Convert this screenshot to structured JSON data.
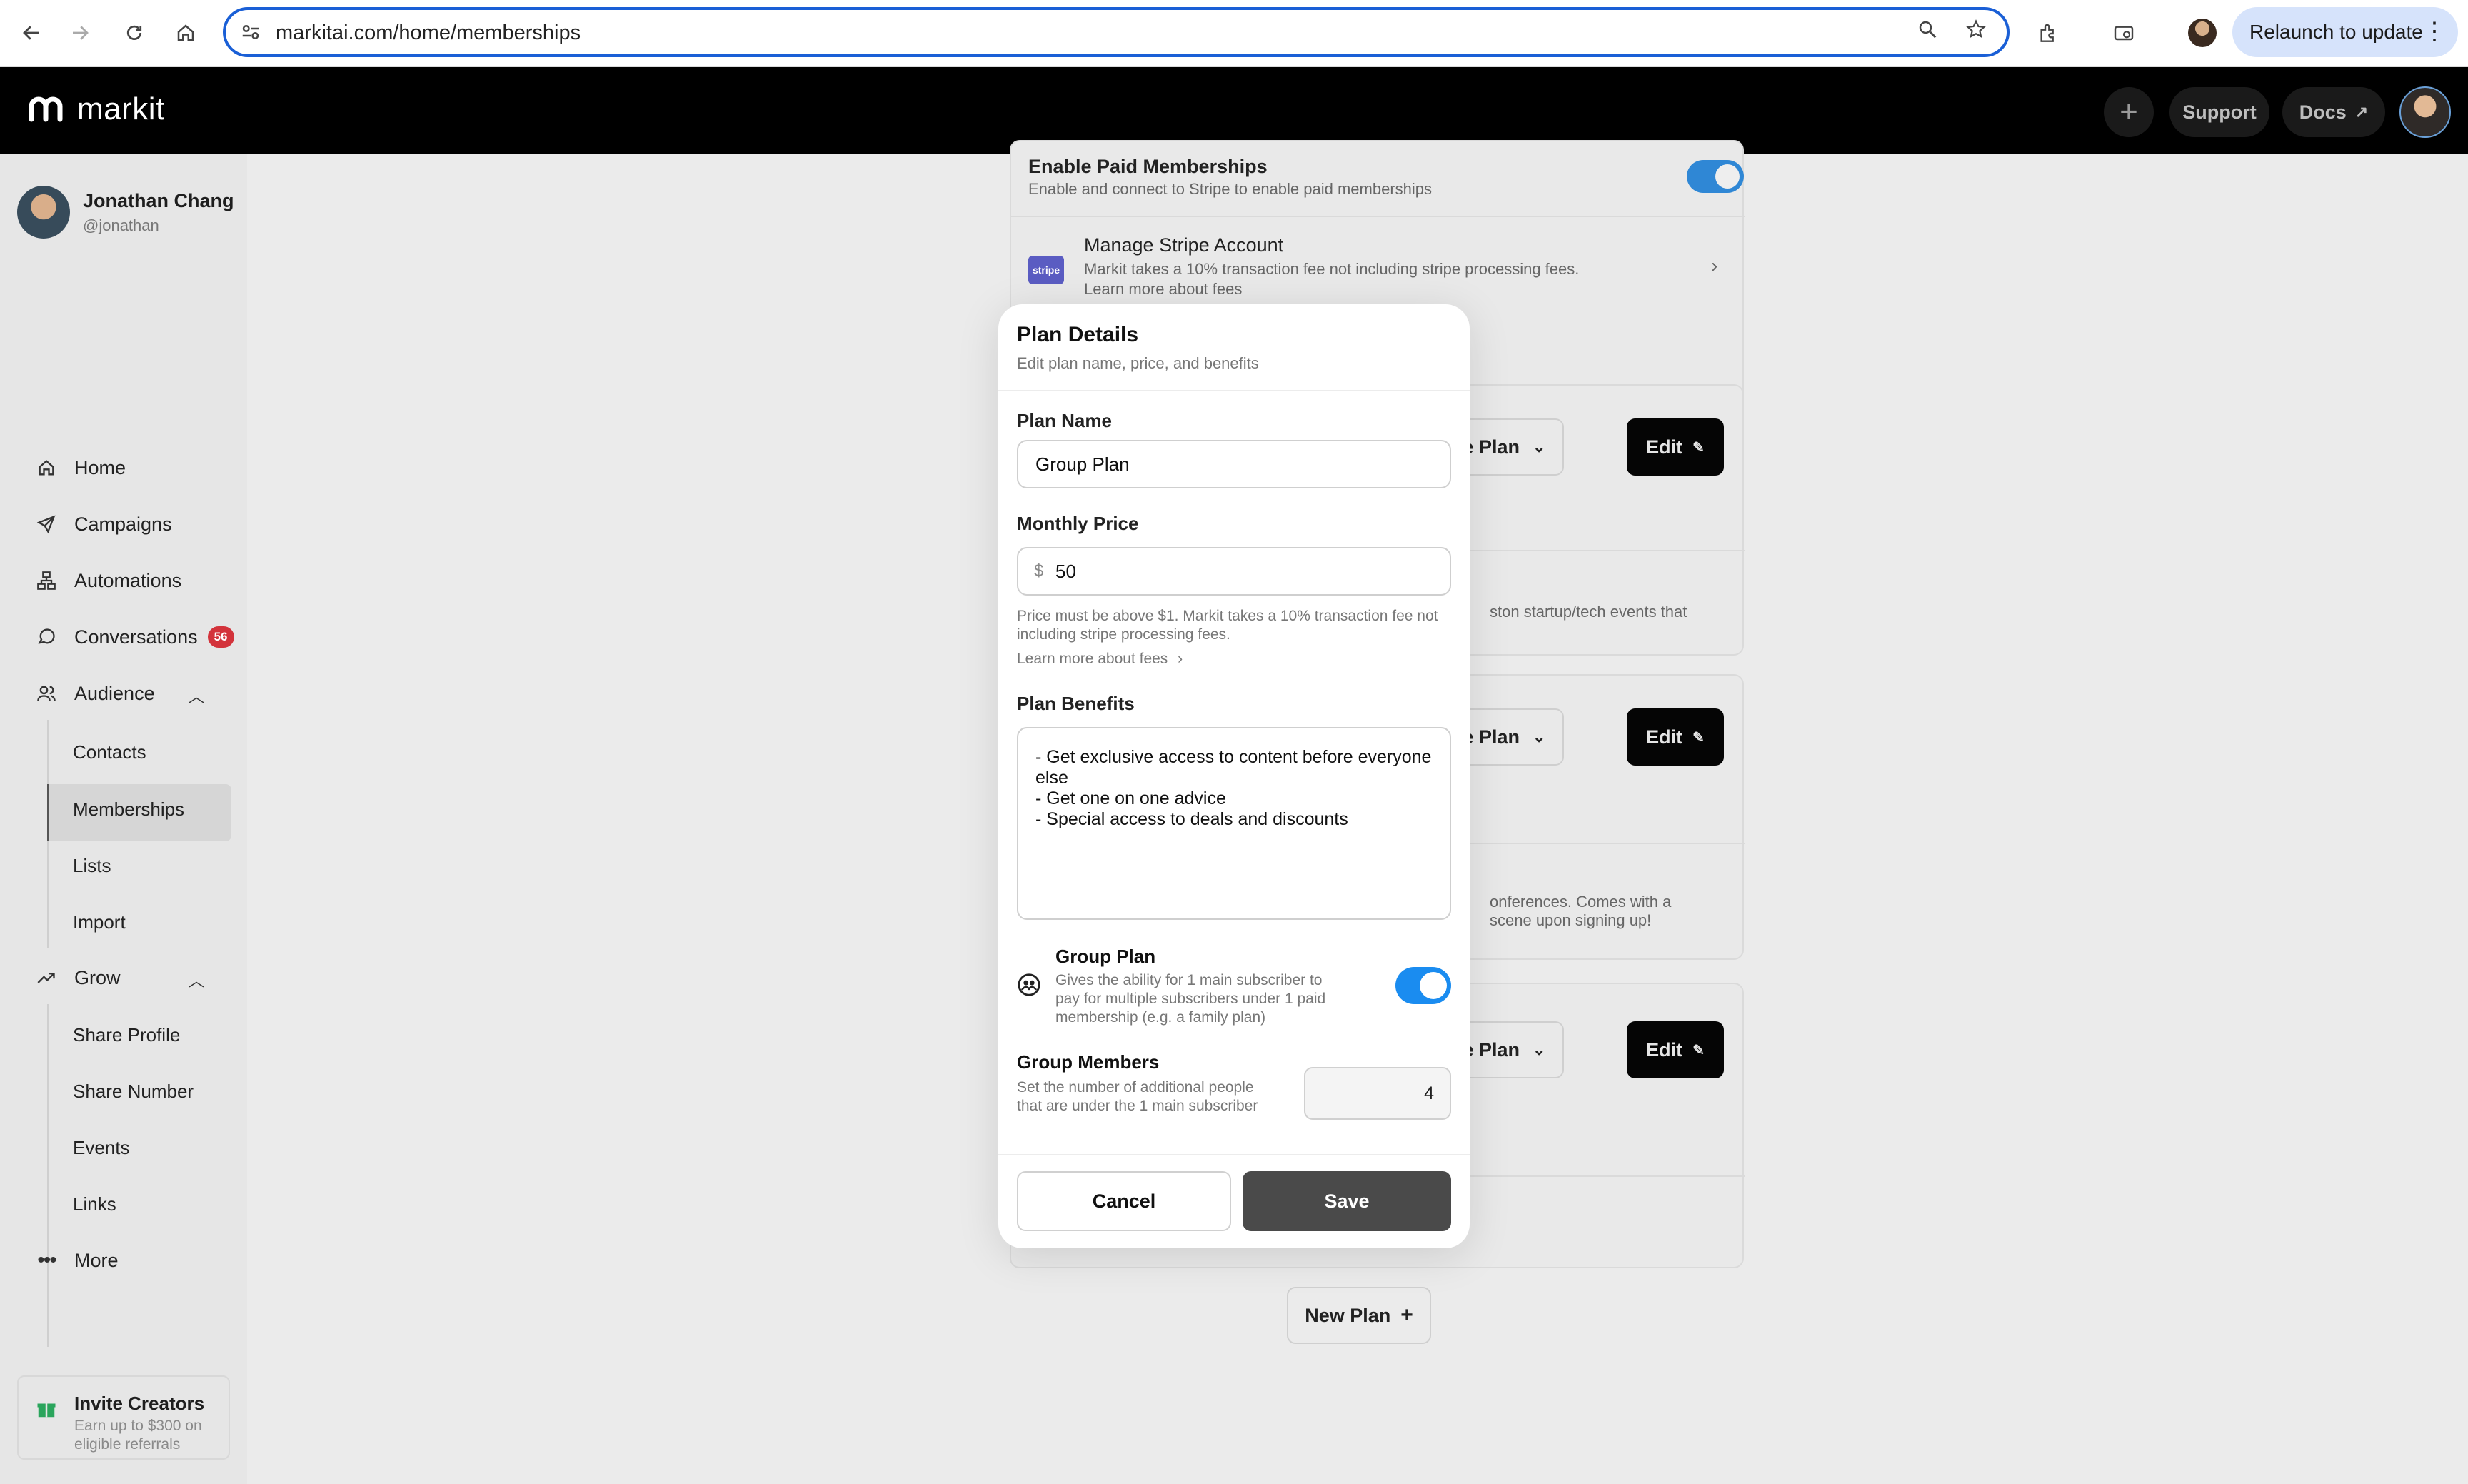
{
  "browser": {
    "url": "markitai.com/home/memberships",
    "relaunch_label": "Relaunch to update"
  },
  "header": {
    "logo_text": "markit",
    "support_label": "Support",
    "docs_label": "Docs"
  },
  "sidebar": {
    "user_name": "Jonathan Chang",
    "user_handle": "@jonathan",
    "items": {
      "home": "Home",
      "campaigns": "Campaigns",
      "automations": "Automations",
      "conversations": "Conversations",
      "conversations_badge": "56",
      "audience": "Audience",
      "contacts": "Contacts",
      "memberships": "Memberships",
      "lists": "Lists",
      "import": "Import",
      "grow": "Grow",
      "share_profile": "Share Profile",
      "share_number": "Share Number",
      "events": "Events",
      "links": "Links",
      "more": "More"
    },
    "invite": {
      "title": "Invite Creators",
      "subtitle": "Earn up to $300 on eligible referrals"
    }
  },
  "background": {
    "paid_title": "Enable Paid Memberships",
    "paid_desc": "Enable and connect to Stripe to enable paid memberships",
    "stripe_logo": "stripe",
    "stripe_title": "Manage Stripe Account",
    "stripe_desc": "Markit takes a 10% transaction fee not including stripe processing fees.",
    "stripe_link": "Learn more about fees",
    "plan_dropdown": "ge Plan",
    "edit_label": "Edit",
    "plan1_desc_fragment": "ston startup/tech events that",
    "plan2_desc_fragment_1": "onferences. Comes with a",
    "plan2_desc_fragment_2": "scene upon signing up!",
    "new_plan_label": "New Plan"
  },
  "modal": {
    "title": "Plan Details",
    "subtitle": "Edit plan name, price, and benefits",
    "plan_name_label": "Plan Name",
    "plan_name_value": "Group Plan",
    "price_label": "Monthly Price",
    "currency_symbol": "$",
    "price_value": "50",
    "price_hint": "Price must be above $1. Markit takes a 10% transaction fee not including stripe processing fees.",
    "fees_link": "Learn more about fees",
    "benefits_label": "Plan Benefits",
    "benefits_value": "- Get exclusive access to content before everyone else\n- Get one on one advice\n- Special access to deals and discounts",
    "group_plan_title": "Group Plan",
    "group_plan_desc": "Gives the ability for 1 main subscriber to pay for multiple subscribers under 1 paid membership (e.g. a family plan)",
    "group_plan_enabled": true,
    "group_members_title": "Group Members",
    "group_members_desc": "Set the number of additional people that are under the 1 main subscriber",
    "group_members_value": "4",
    "cancel_label": "Cancel",
    "save_label": "Save"
  },
  "colors": {
    "accent_toggle": "#1a8cf0",
    "badge": "#d3333b",
    "save_button": "#4a4a4a",
    "url_focus": "#1a5fd6"
  }
}
